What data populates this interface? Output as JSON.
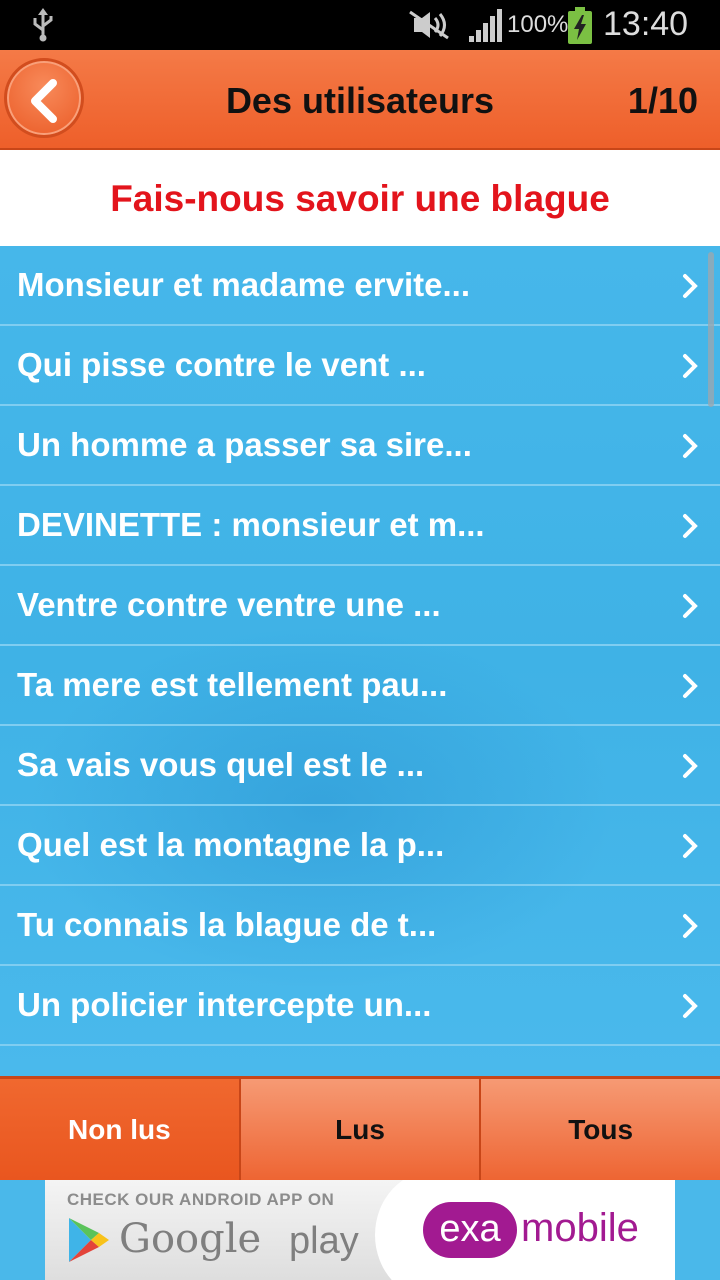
{
  "status_bar": {
    "battery_percent": "100%",
    "time": "13:40"
  },
  "header": {
    "title": "Des utilisateurs",
    "page_counter": "1/10"
  },
  "banner": {
    "text": "Fais-nous savoir une blague"
  },
  "list": {
    "items": [
      {
        "label": "Monsieur et madame ervite..."
      },
      {
        "label": "Qui pisse contre le vent ..."
      },
      {
        "label": "Un homme a passer sa sire..."
      },
      {
        "label": "DEVINETTE : monsieur et m..."
      },
      {
        "label": "Ventre contre ventre une ..."
      },
      {
        "label": "Ta mere est tellement pau..."
      },
      {
        "label": "Sa vais vous quel est le ..."
      },
      {
        "label": "Quel est la montagne la p..."
      },
      {
        "label": "Tu connais la blague de t..."
      },
      {
        "label": "Un policier intercepte un..."
      }
    ]
  },
  "tabs": [
    {
      "label": "Non lus",
      "active": true
    },
    {
      "label": "Lus",
      "active": false
    },
    {
      "label": "Tous",
      "active": false
    }
  ],
  "ad": {
    "caption": "CHECK OUR ANDROID APP ON",
    "google": "Google",
    "play": "play",
    "exa": "exa",
    "mobile": "mobile"
  },
  "colors": {
    "header_orange": "#ee5f2a",
    "list_blue": "#46b7ea",
    "banner_red": "#e3141c",
    "exa_purple": "#a21a91"
  }
}
